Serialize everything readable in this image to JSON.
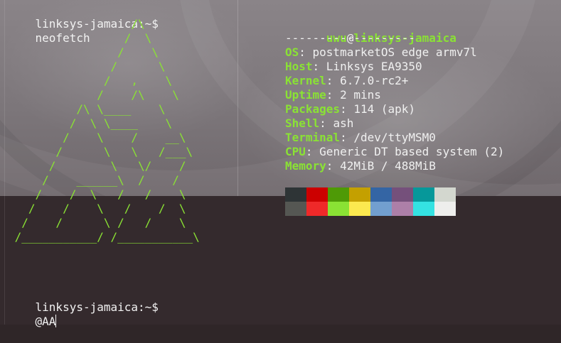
{
  "terminal": {
    "prompt_host": "linksys-jamaica:~$",
    "command_1": "neofetch",
    "command_2": "@AA"
  },
  "ascii_art": "                  /\\\n                 /  \\\n                /    \\\n               /      \\\n              /   ,    \\\n             /    /\\    \\\n          /\\ \\____    \\\n         /  \\ \\____    \\\n        /    \\    /    __\\\n       /      \\   \\   /___\\\n      /        \\   \\/    /\n     /    ______\\  /    /\n    /    /  \\   /   /    \\\n   /    /    \\   /    /  \\\n  /    /      \\ /   /    \\\n /___________/ /___________\\",
  "neofetch": {
    "user": "uwu",
    "at": "@",
    "host": "linksys-jamaica",
    "separator": "-------------------",
    "rows": [
      {
        "key": "OS",
        "value": "postmarketOS edge armv7l"
      },
      {
        "key": "Host",
        "value": "Linksys EA9350"
      },
      {
        "key": "Kernel",
        "value": "6.7.0-rc2+"
      },
      {
        "key": "Uptime",
        "value": "2 mins"
      },
      {
        "key": "Packages",
        "value": "114 (apk)"
      },
      {
        "key": "Shell",
        "value": "ash"
      },
      {
        "key": "Terminal",
        "value": "/dev/ttyMSM0"
      },
      {
        "key": "CPU",
        "value": "Generic DT based system (2)"
      },
      {
        "key": "Memory",
        "value": "42MiB / 488MiB"
      }
    ]
  },
  "palette": {
    "normal": [
      "#2e3436",
      "#cc0000",
      "#4e9a06",
      "#c4a000",
      "#3465a4",
      "#75507b",
      "#06989a",
      "#d3d7cf"
    ],
    "bright": [
      "#555753",
      "#ef2929",
      "#8ae234",
      "#fce94f",
      "#729fcf",
      "#ad7fa8",
      "#34e2e2",
      "#eeeeec"
    ]
  }
}
